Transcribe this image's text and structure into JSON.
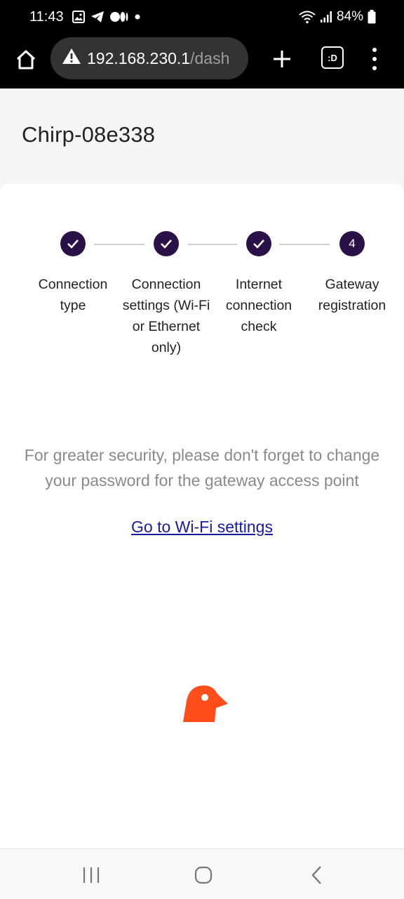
{
  "status_bar": {
    "time": "11:43",
    "battery": "84%",
    "icons_left": [
      "gallery-icon",
      "telegram-icon",
      "medium-icon",
      "dot-icon"
    ],
    "icons_right": [
      "wifi-icon",
      "signal-icon",
      "battery-icon"
    ]
  },
  "browser": {
    "url_host": "192.168.230.1",
    "url_path": "/dash",
    "tabs_label": ":D"
  },
  "page": {
    "device_title": "Chirp-08e338"
  },
  "stepper": {
    "steps": [
      {
        "label": "Connection type",
        "state": "done",
        "number": ""
      },
      {
        "label": "Connection settings (Wi-Fi or Ethernet only)",
        "state": "done",
        "number": ""
      },
      {
        "label": "Internet connection check",
        "state": "done",
        "number": ""
      },
      {
        "label": "Gateway registration",
        "state": "current",
        "number": "4"
      }
    ],
    "accent_color": "#2a1249"
  },
  "main": {
    "message": "For greater security, please don't forget to change your password for the gateway access point",
    "wifi_link": "Go to Wi-Fi settings"
  },
  "logo": {
    "name": "chirp-bird-logo",
    "color": "#ff4e1a"
  },
  "nav_bar": {
    "buttons": [
      "recents-icon",
      "home-icon",
      "back-icon"
    ]
  }
}
